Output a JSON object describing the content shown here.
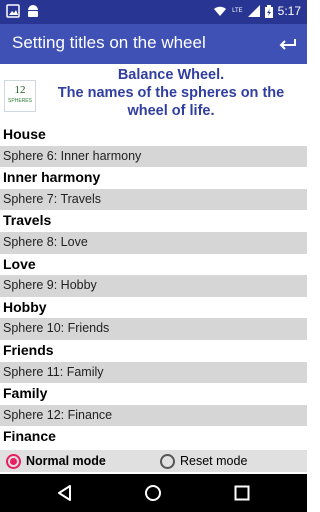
{
  "status_bar": {
    "left_icons": [
      "image-icon",
      "android-icon"
    ],
    "right_icons": [
      "wifi-icon",
      "lte-signal-icon",
      "battery-charging-icon"
    ],
    "time": "5:17",
    "lte_label": "LTE"
  },
  "app_bar": {
    "title": "Setting titles on the wheel",
    "back_icon": "back-arrow-icon"
  },
  "header": {
    "logo": {
      "number": "12",
      "caption": "SPHERES"
    },
    "line1": "Balance Wheel.",
    "line2": "The names of the spheres on the wheel of life."
  },
  "list": [
    {
      "type": "title",
      "text": "House"
    },
    {
      "type": "sphere",
      "text": "Sphere 6: Inner harmony"
    },
    {
      "type": "title",
      "text": "Inner harmony"
    },
    {
      "type": "sphere",
      "text": "Sphere 7: Travels"
    },
    {
      "type": "title",
      "text": "Travels"
    },
    {
      "type": "sphere",
      "text": "Sphere 8: Love"
    },
    {
      "type": "title",
      "text": "Love"
    },
    {
      "type": "sphere",
      "text": "Sphere 9: Hobby"
    },
    {
      "type": "title",
      "text": "Hobby"
    },
    {
      "type": "sphere",
      "text": "Sphere 10: Friends"
    },
    {
      "type": "title",
      "text": "Friends"
    },
    {
      "type": "sphere",
      "text": "Sphere 11: Family"
    },
    {
      "type": "title",
      "text": "Family"
    },
    {
      "type": "sphere",
      "text": "Sphere 12: Finance"
    },
    {
      "type": "title",
      "text": "Finance"
    }
  ],
  "mode_bar": {
    "normal": {
      "label": "Normal mode",
      "selected": true
    },
    "reset": {
      "label": "Reset mode",
      "selected": false
    }
  },
  "nav_bar": {
    "icons": [
      "back-triangle-icon",
      "home-circle-icon",
      "recents-square-icon"
    ]
  },
  "colors": {
    "status_bar": "#283593",
    "app_bar": "#3f51b5",
    "header_text": "#303f9f",
    "row_gray": "#d6d6d6",
    "accent_radio": "#e91e63"
  }
}
